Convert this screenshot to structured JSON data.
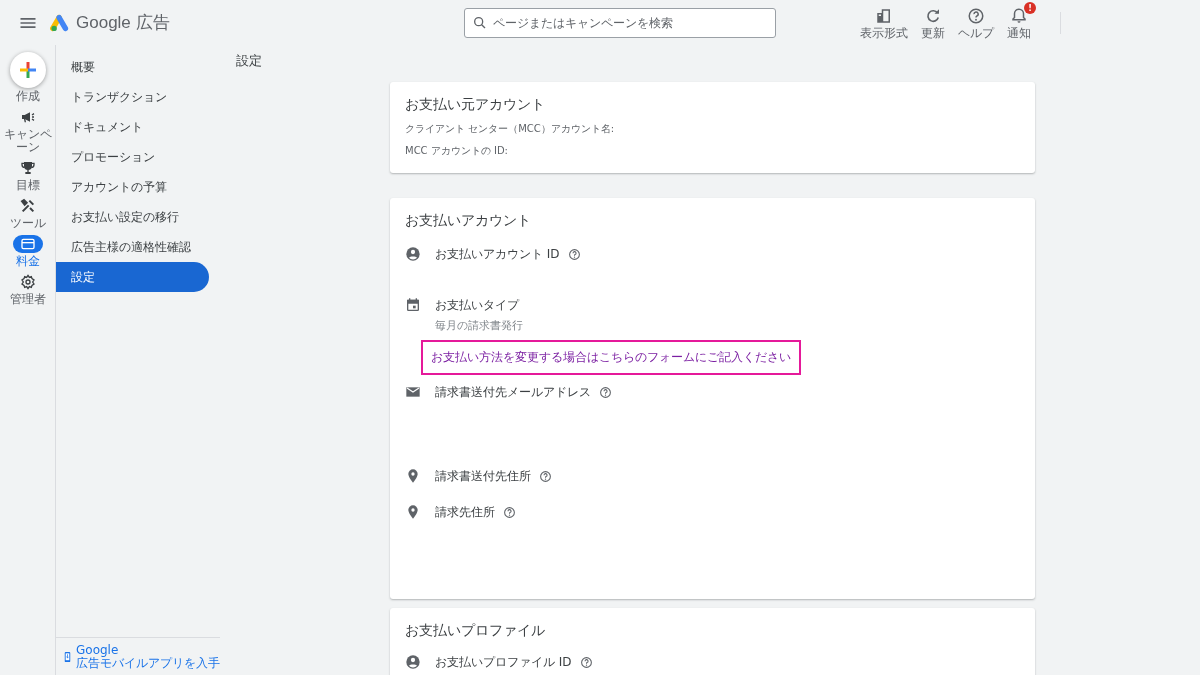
{
  "header": {
    "product": "Google 広告",
    "search": {
      "placeholder": "ページまたはキャンペーンを検索"
    },
    "actions": [
      {
        "label": "表示形式"
      },
      {
        "label": "更新"
      },
      {
        "label": "ヘルプ"
      },
      {
        "label": "通知",
        "badge": "!"
      }
    ]
  },
  "rail": {
    "create": {
      "label": "作成"
    },
    "items": [
      {
        "label": "キャンペーン",
        "selected": false
      },
      {
        "label": "目標",
        "selected": false
      },
      {
        "label": "ツール",
        "selected": false
      },
      {
        "label": "料金",
        "selected": true
      },
      {
        "label": "管理者",
        "selected": false
      }
    ]
  },
  "sidebar": {
    "items": [
      {
        "label": "概要",
        "selected": false
      },
      {
        "label": "トランザクション",
        "selected": false
      },
      {
        "label": "ドキュメント",
        "selected": false
      },
      {
        "label": "プロモーション",
        "selected": false
      },
      {
        "label": "アカウントの予算",
        "selected": false
      },
      {
        "label": "お支払い設定の移行",
        "selected": false
      },
      {
        "label": "広告主様の適格性確認",
        "selected": false
      },
      {
        "label": "設定",
        "selected": true
      }
    ],
    "app_link": {
      "lines": [
        "Google",
        "広告モバイルアプリを入手"
      ]
    }
  },
  "page_title": "設定",
  "cards": [
    {
      "title": "お支払い元アカウント",
      "fields": [
        "クライアント センター（MCC）アカウント名:",
        "MCC アカウントの ID:"
      ]
    },
    {
      "title": "お支払いアカウント",
      "rows": [
        {
          "label": "お支払いアカウント ID",
          "help": true
        },
        {
          "label": "お支払いタイプ",
          "help": false,
          "value": "毎月の請求書発行",
          "link": {
            "text": "お支払い方法を変更する場合はこちらのフォームにご記入ください",
            "highlighted": true
          }
        },
        {
          "label": "請求書送付先メールアドレス",
          "help": true
        },
        {
          "label": "請求書送付先住所",
          "help": true
        },
        {
          "label": "請求先住所",
          "help": true
        }
      ]
    },
    {
      "title": "お支払いプロファイル",
      "rows": [
        {
          "label": "お支払いプロファイル ID",
          "help": true
        }
      ]
    }
  ]
}
